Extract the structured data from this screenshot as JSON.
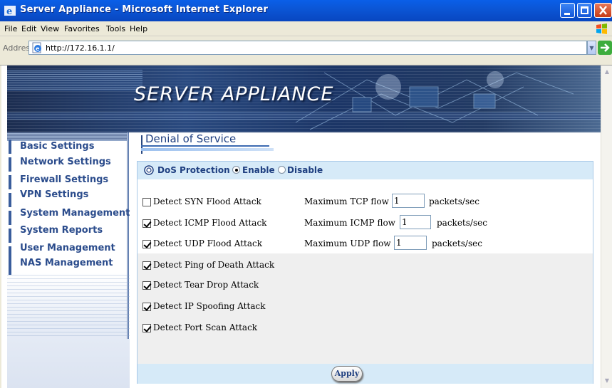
{
  "window": {
    "title": "Server Appliance - Microsoft Internet Explorer"
  },
  "menu": {
    "items": [
      "File",
      "Edit",
      "View",
      "Favorites",
      "Tools",
      "Help"
    ]
  },
  "address": {
    "label": "Address",
    "url": "http://172.16.1.1/",
    "go_label": "Go"
  },
  "banner": {
    "title": "SERVER APPLIANCE"
  },
  "sidebar": {
    "items": [
      {
        "label": "Basic Settings"
      },
      {
        "label": "Network Settings"
      },
      {
        "label": "Firewall Settings"
      },
      {
        "label": "VPN Settings"
      },
      {
        "label": "System Management"
      },
      {
        "label": "System Reports"
      },
      {
        "label": "User Management"
      },
      {
        "label": "NAS Management"
      }
    ]
  },
  "page": {
    "title": "Denial of Service",
    "dos_label": "DoS Protection :",
    "enable_label": "Enable",
    "disable_label": "Disable",
    "dos_state": "Enable",
    "rows": [
      {
        "label": "Detect SYN Flood Attack",
        "checked": false,
        "max_label": "Maximum TCP flow",
        "value": "1",
        "unit": "packets/sec"
      },
      {
        "label": "Detect ICMP Flood Attack",
        "checked": true,
        "max_label": "Maximum ICMP flow",
        "value": "1",
        "unit": "packets/sec"
      },
      {
        "label": "Detect UDP Flood Attack",
        "checked": true,
        "max_label": "Maximum UDP flow",
        "value": "1",
        "unit": "packets/sec"
      },
      {
        "label": "Detect Ping of Death Attack",
        "checked": true
      },
      {
        "label": "Detect Tear Drop Attack",
        "checked": true
      },
      {
        "label": "Detect IP Spoofing Attack",
        "checked": true
      },
      {
        "label": "Detect Port Scan Attack",
        "checked": true
      }
    ],
    "apply_label": "Apply"
  }
}
